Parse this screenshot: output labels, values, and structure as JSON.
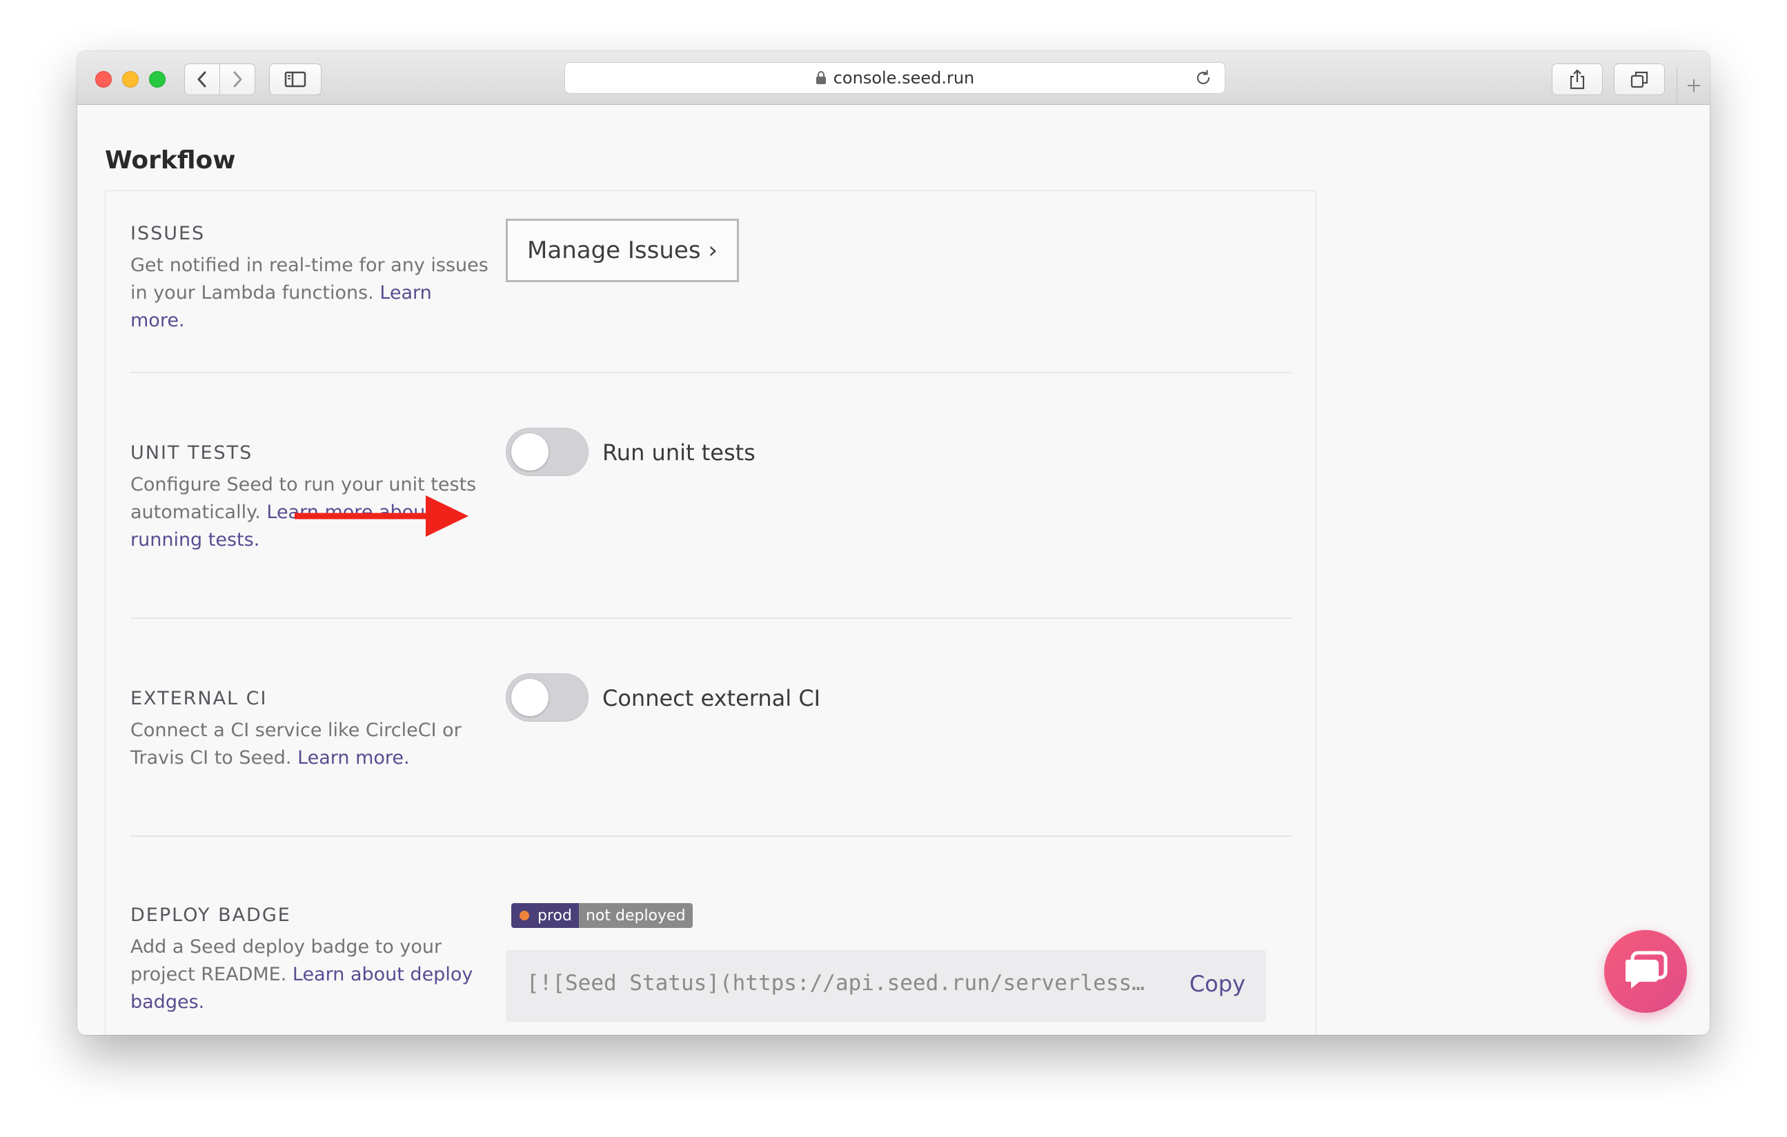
{
  "browser": {
    "url": "console.seed.run"
  },
  "page": {
    "title": "Workflow"
  },
  "sections": {
    "issues": {
      "title": "ISSUES",
      "desc": "Get notified in real-time for any issues in your Lambda functions.",
      "link": "Learn more.",
      "button": "Manage Issues ›"
    },
    "unit_tests": {
      "title": "UNIT TESTS",
      "desc": "Configure Seed to run your unit tests automatically.",
      "link": "Learn more about running tests.",
      "toggle_label": "Run unit tests",
      "enabled": false
    },
    "external_ci": {
      "title": "EXTERNAL CI",
      "desc": "Connect a CI service like CircleCI or Travis CI to Seed.",
      "link": "Learn more.",
      "toggle_label": "Connect external CI",
      "enabled": false
    },
    "deploy_badge": {
      "title": "DEPLOY BADGE",
      "desc": "Add a Seed deploy badge to your project README.",
      "link": "Learn about deploy badges.",
      "badge_stage": "prod",
      "badge_status": "not deployed",
      "code": "[![Seed Status](https://api.seed.run/serverless…",
      "copy_label": "Copy"
    }
  },
  "colors": {
    "link": "#5a4b91",
    "arrow": "#f0231b",
    "chat": "#f0577f"
  },
  "icons": {
    "chat": "chat-bubble-icon"
  }
}
